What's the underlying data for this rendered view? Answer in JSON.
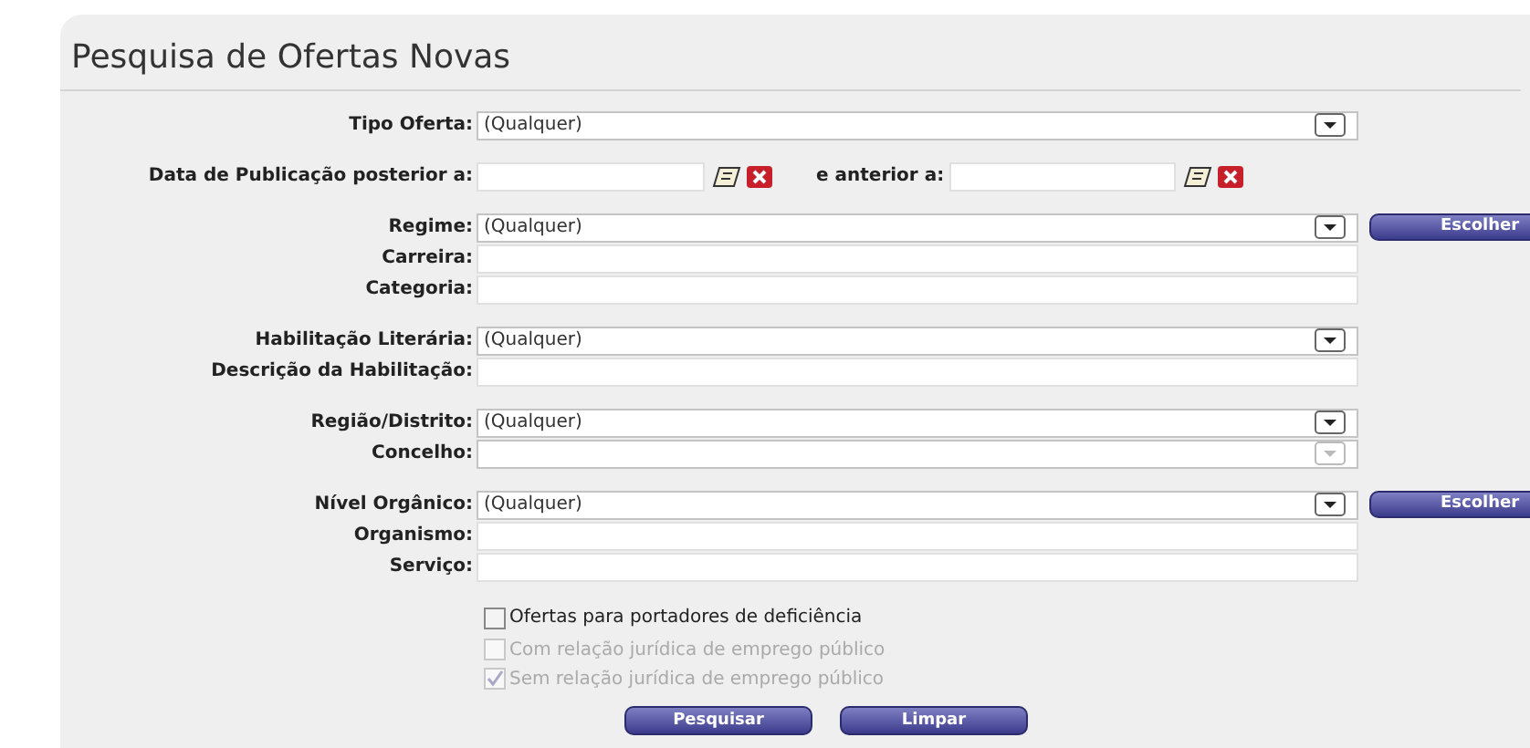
{
  "title": "Pesquisa de Ofertas Novas",
  "groups": [
    [
      {
        "kind": "select",
        "label": "Tipo Oferta:",
        "value": "(Qualquer)",
        "disabled": false
      }
    ],
    [
      {
        "kind": "date_range",
        "label": "Data de Publicação posterior a:",
        "second_label": "e anterior a:"
      }
    ],
    [
      {
        "kind": "select",
        "label": "Regime:",
        "value": "(Qualquer)",
        "disabled": false,
        "button": "Escolher"
      },
      {
        "kind": "text",
        "label": "Carreira:"
      },
      {
        "kind": "text",
        "label": "Categoria:"
      }
    ],
    [
      {
        "kind": "select",
        "label": "Habilitação Literária:",
        "value": "(Qualquer)",
        "disabled": false
      },
      {
        "kind": "text",
        "label": "Descrição da Habilitação:"
      }
    ],
    [
      {
        "kind": "select",
        "label": "Região/Distrito:",
        "value": "(Qualquer)",
        "disabled": false
      },
      {
        "kind": "select",
        "label": "Concelho:",
        "disabled": true
      }
    ],
    [
      {
        "kind": "select",
        "label": "Nível Orgânico:",
        "value": "(Qualquer)",
        "disabled": false,
        "button": "Escolher"
      },
      {
        "kind": "text",
        "label": "Organismo:"
      },
      {
        "kind": "text",
        "label": "Serviço:"
      }
    ]
  ],
  "checkboxes": [
    {
      "label": "Ofertas para portadores de deficiência",
      "checked": false,
      "disabled": false
    },
    {
      "label": "Com relação jurídica de emprego público",
      "checked": false,
      "disabled": true
    },
    {
      "label": "Sem relação jurídica de emprego público",
      "checked": true,
      "disabled": true
    }
  ],
  "buttons": [
    "Pesquisar",
    "Limpar"
  ]
}
